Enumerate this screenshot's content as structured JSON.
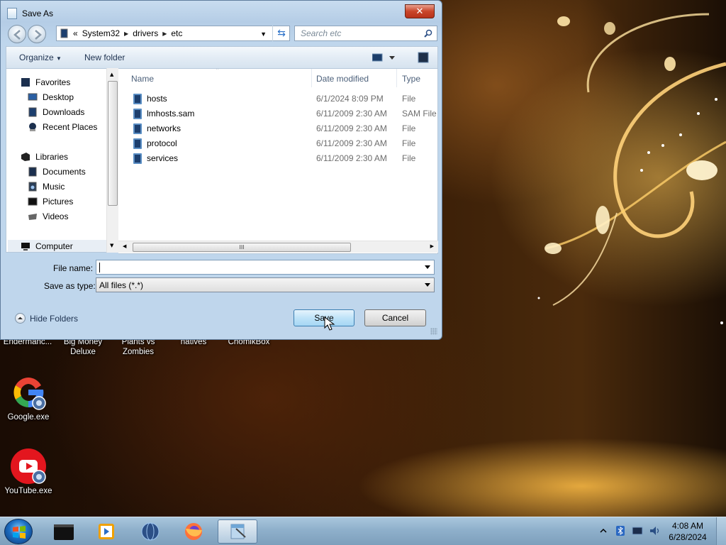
{
  "desktop": {
    "top_labels": [
      "Endermanc...",
      "Big Money\nDeluxe",
      "Plants vs\nZombies",
      "natives",
      "ChomikBox"
    ],
    "icons": [
      {
        "label": "Google.exe",
        "icon": "google-icon"
      },
      {
        "label": "YouTube.exe",
        "icon": "youtube-icon"
      }
    ]
  },
  "dialog": {
    "title": "Save As",
    "close_glyph": "✕",
    "address": {
      "prefix": "«",
      "crumbs": [
        "System32",
        "drivers",
        "etc"
      ]
    },
    "search_placeholder": "Search etc",
    "toolbar": {
      "organize": "Organize",
      "new_folder": "New folder"
    },
    "nav": {
      "favorites": "Favorites",
      "favorites_items": [
        "Desktop",
        "Downloads",
        "Recent Places"
      ],
      "libraries": "Libraries",
      "libraries_items": [
        "Documents",
        "Music",
        "Pictures",
        "Videos"
      ],
      "computer": "Computer"
    },
    "columns": {
      "name": "Name",
      "date": "Date modified",
      "type": "Type"
    },
    "files": [
      {
        "name": "hosts",
        "date": "6/1/2024 8:09 PM",
        "type": "File"
      },
      {
        "name": "lmhosts.sam",
        "date": "6/11/2009 2:30 AM",
        "type": "SAM File"
      },
      {
        "name": "networks",
        "date": "6/11/2009 2:30 AM",
        "type": "File"
      },
      {
        "name": "protocol",
        "date": "6/11/2009 2:30 AM",
        "type": "File"
      },
      {
        "name": "services",
        "date": "6/11/2009 2:30 AM",
        "type": "File"
      }
    ],
    "scroll_grip": "III",
    "file_name_label": "File name:",
    "file_name_value": "",
    "save_type_label": "Save as type:",
    "save_type_value": "All files (*.*)",
    "hide_folders": "Hide Folders",
    "save": "Save",
    "cancel": "Cancel"
  },
  "taskbar": {
    "time": "4:08 AM",
    "date": "6/28/2024"
  },
  "colors": {
    "accent": "#3c7fb1",
    "taskbar": "#8fb0cb"
  }
}
